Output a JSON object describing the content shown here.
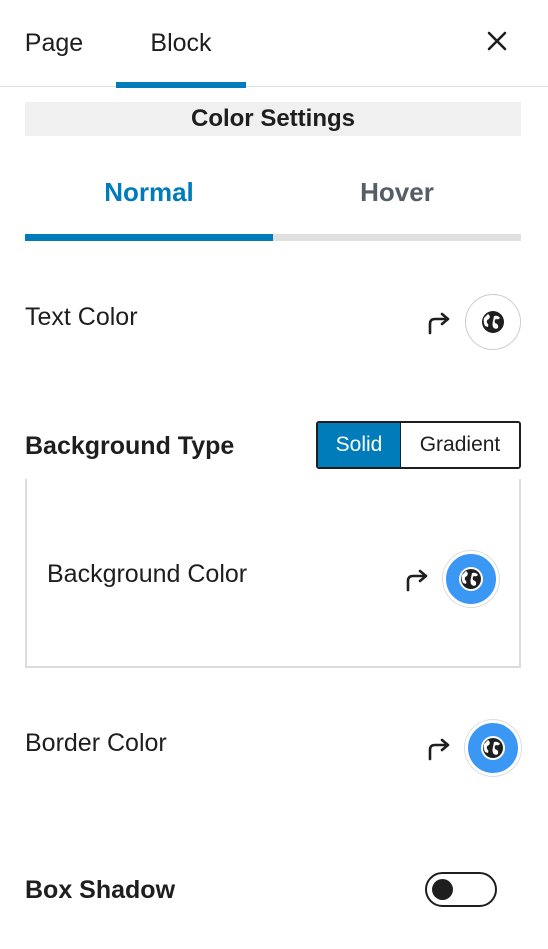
{
  "tabs": {
    "page": "Page",
    "block": "Block",
    "active": "Block"
  },
  "icons": {
    "close": "close-icon",
    "reset": "redo-arrow-icon",
    "color": "globe-icon",
    "toggle": "toggle-switch"
  },
  "colors": {
    "accent": "#007cba",
    "swatch_filled": "#3b97f4"
  },
  "color_settings": {
    "title": "Color Settings",
    "state_tabs": {
      "normal": "Normal",
      "hover": "Hover",
      "active": "Normal"
    },
    "text_color": {
      "label": "Text Color",
      "swatch": "none"
    },
    "background_type": {
      "label": "Background Type",
      "options": [
        "Solid",
        "Gradient"
      ],
      "selected": "Solid"
    },
    "background_color": {
      "label": "Background Color",
      "swatch": "#3b97f4"
    },
    "border_color": {
      "label": "Border Color",
      "swatch": "#3b97f4"
    },
    "box_shadow": {
      "label": "Box Shadow",
      "enabled": false
    }
  }
}
